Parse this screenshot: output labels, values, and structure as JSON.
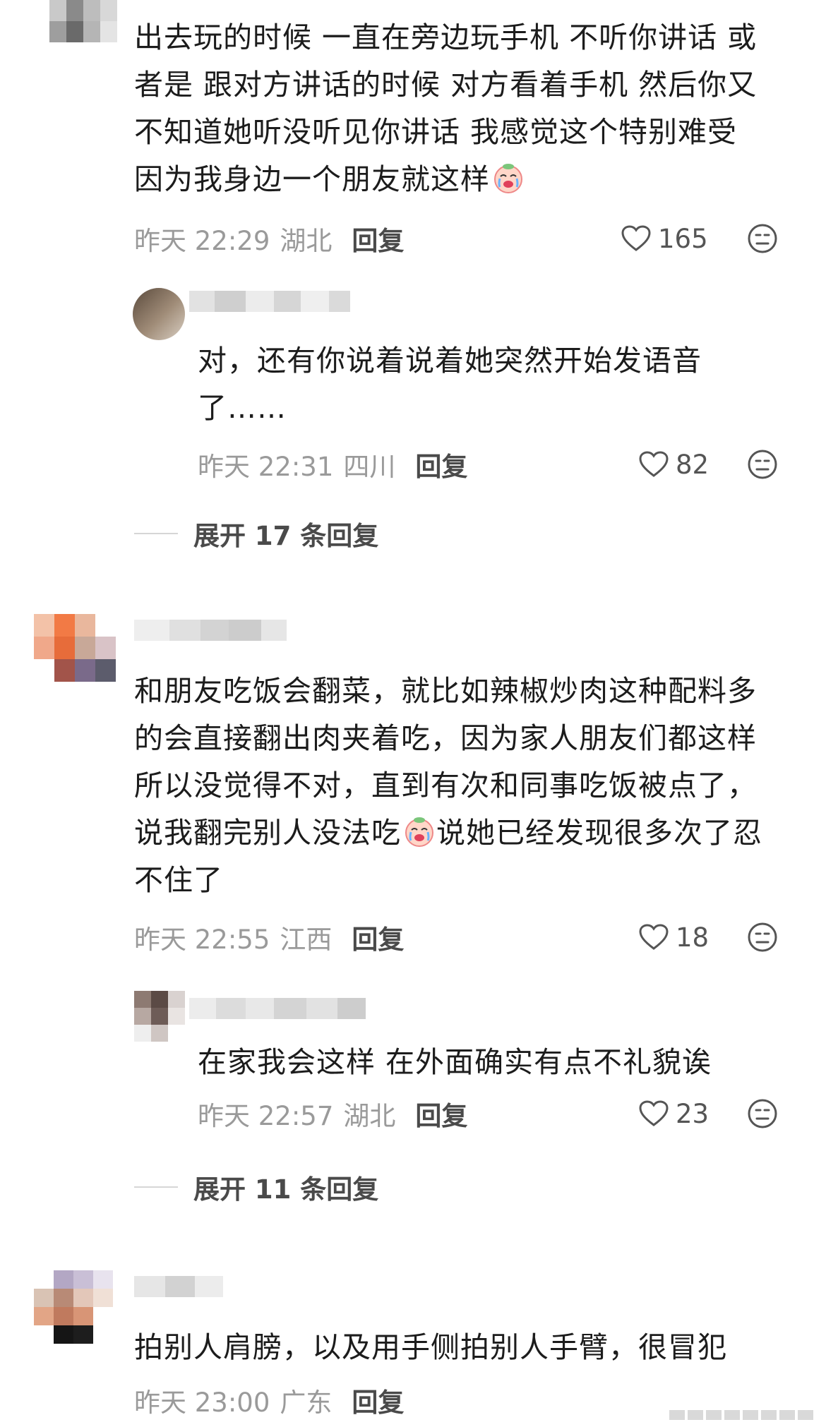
{
  "comments": [
    {
      "text": "出去玩的时候 一直在旁边玩手机 不听你讲话 或\n者是 跟对方讲话的时候 对方看着手机 然后你又\n不知道她听没听见你讲话 我感觉这个特别难受\n因为我身边一个朋友就这样",
      "time": "昨天 22:29",
      "location": "湖北",
      "reply_label": "回复",
      "likes": "165",
      "replies": [
        {
          "text": "对，还有你说着说着她突然开始发语音\n了……",
          "time": "昨天 22:31",
          "location": "四川",
          "reply_label": "回复",
          "likes": "82"
        }
      ],
      "expand_label": "展开 17 条回复"
    },
    {
      "text_parts": [
        "和朋友吃饭会翻菜，就比如辣椒炒肉这种配料多\n的会直接翻出肉夹着吃，因为家人朋友们都这样\n所以没觉得不对，直到有次和同事吃饭被点了，\n说我翻完别人没法吃",
        "说她已经发现很多次了忍\n不住了"
      ],
      "time": "昨天 22:55",
      "location": "江西",
      "reply_label": "回复",
      "likes": "18",
      "replies": [
        {
          "text": "在家我会这样 在外面确实有点不礼貌诶",
          "time": "昨天 22:57",
          "location": "湖北",
          "reply_label": "回复",
          "likes": "23"
        }
      ],
      "expand_label": "展开 11 条回复"
    },
    {
      "text": "拍别人肩膀，以及用手侧拍别人手臂，很冒犯",
      "time": "昨天 23:00",
      "location": "广东",
      "reply_label": "回复"
    }
  ],
  "icons": {
    "like": "heart-outline-icon",
    "dislike": "neutral-face-icon",
    "emoji": "crying-face-emoji"
  },
  "colors": {
    "meta_text": "#9a9a9a",
    "reply_text": "#4a4a4a",
    "body_text": "#1c1c1c"
  }
}
